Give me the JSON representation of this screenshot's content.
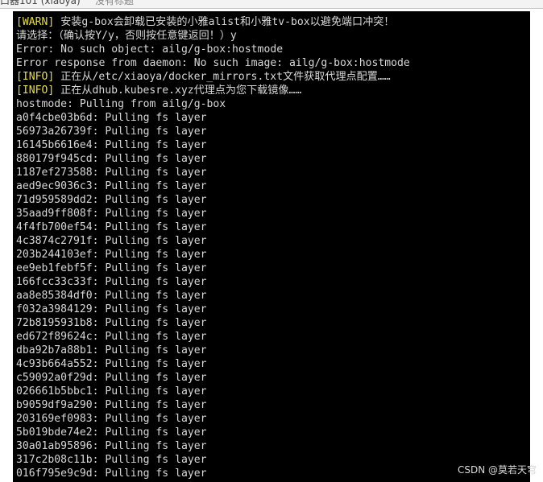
{
  "tabs": [
    {
      "label": "口器101 (xiaoya)"
    },
    {
      "label": "没有标题"
    }
  ],
  "terminal": {
    "lines": [
      {
        "tag": "[WARN]",
        "text": " 安装g-box会卸载已安装的小雅alist和小雅tv-box以避免端口冲突！"
      },
      {
        "tag": "",
        "text": "请选择：（确认按Y/y，否则按任意键返回！）y"
      },
      {
        "tag": "",
        "text": "Error: No such object: ailg/g-box:hostmode"
      },
      {
        "tag": "",
        "text": "Error response from daemon: No such image: ailg/g-box:hostmode"
      },
      {
        "tag": "[INFO]",
        "text": " 正在从/etc/xiaoya/docker_mirrors.txt文件获取代理点配置……"
      },
      {
        "tag": "[INFO]",
        "text": " 正在从dhub.kubesre.xyz代理点为您下载镜像……"
      },
      {
        "tag": "",
        "text": "hostmode: Pulling from ailg/g-box"
      },
      {
        "tag": "",
        "text": "a0f4cbe03b6d: Pulling fs layer"
      },
      {
        "tag": "",
        "text": "56973a26739f: Pulling fs layer"
      },
      {
        "tag": "",
        "text": "16145b6616e4: Pulling fs layer"
      },
      {
        "tag": "",
        "text": "880179f945cd: Pulling fs layer"
      },
      {
        "tag": "",
        "text": "1187ef273588: Pulling fs layer"
      },
      {
        "tag": "",
        "text": "aed9ec9036c3: Pulling fs layer"
      },
      {
        "tag": "",
        "text": "71d959589dd2: Pulling fs layer"
      },
      {
        "tag": "",
        "text": "35aad9ff808f: Pulling fs layer"
      },
      {
        "tag": "",
        "text": "4f4fb700ef54: Pulling fs layer"
      },
      {
        "tag": "",
        "text": "4c3874c2791f: Pulling fs layer"
      },
      {
        "tag": "",
        "text": "203b244103ef: Pulling fs layer"
      },
      {
        "tag": "",
        "text": "ee9eb1febf5f: Pulling fs layer"
      },
      {
        "tag": "",
        "text": "166fcc33c33f: Pulling fs layer"
      },
      {
        "tag": "",
        "text": "aa8e85384df0: Pulling fs layer"
      },
      {
        "tag": "",
        "text": "f032a3984129: Pulling fs layer"
      },
      {
        "tag": "",
        "text": "72b8195931b8: Pulling fs layer"
      },
      {
        "tag": "",
        "text": "ed672f89624c: Pulling fs layer"
      },
      {
        "tag": "",
        "text": "dba92b7a88b1: Pulling fs layer"
      },
      {
        "tag": "",
        "text": "4c93b664a552: Pulling fs layer"
      },
      {
        "tag": "",
        "text": "c59092a0f29d: Pulling fs layer"
      },
      {
        "tag": "",
        "text": "026661b5bbc1: Pulling fs layer"
      },
      {
        "tag": "",
        "text": "b9059df9a290: Pulling fs layer"
      },
      {
        "tag": "",
        "text": "203169ef0983: Pulling fs layer"
      },
      {
        "tag": "",
        "text": "5b019bde74e2: Pulling fs layer"
      },
      {
        "tag": "",
        "text": "30a01ab95896: Pulling fs layer"
      },
      {
        "tag": "",
        "text": "317c2b08c11b: Pulling fs layer"
      },
      {
        "tag": "",
        "text": "016f795e9c9d: Pulling fs layer"
      }
    ]
  },
  "colors": {
    "terminal_bg": "#000000",
    "terminal_text": "#d8d8d8",
    "tag_text": "#e8e036"
  },
  "watermark": "CSDN @莫若天穹"
}
